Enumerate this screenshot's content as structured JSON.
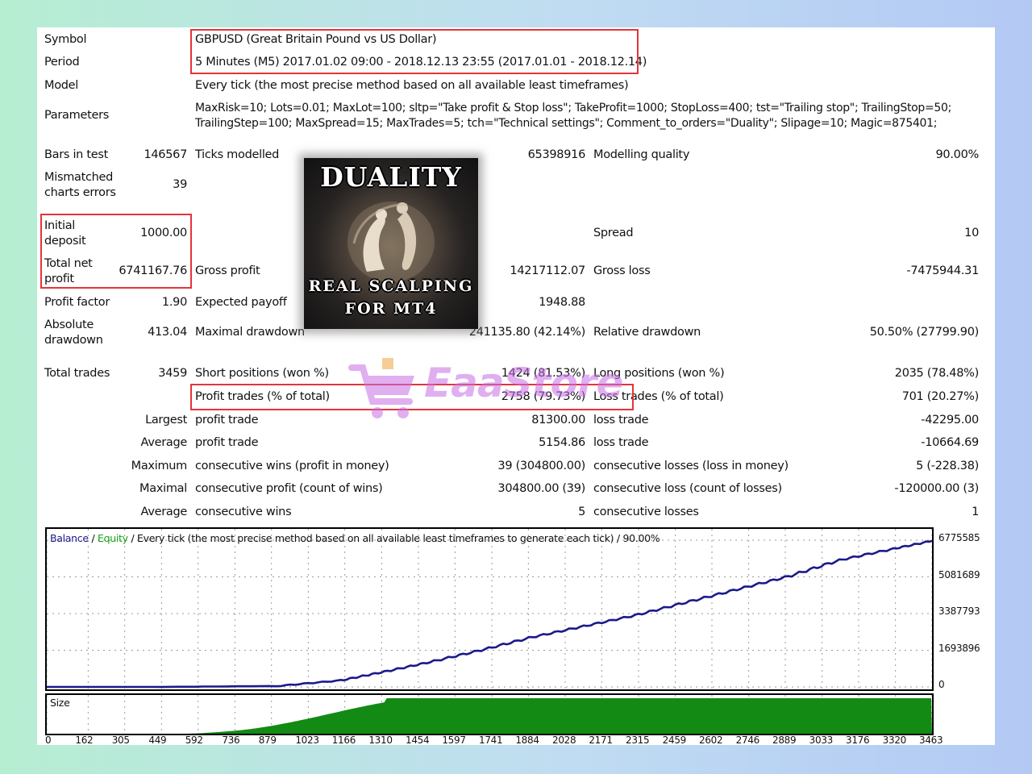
{
  "report": {
    "symbol_label": "Symbol",
    "symbol_value": "GBPUSD (Great Britain Pound vs US Dollar)",
    "period_label": "Period",
    "period_value": "5 Minutes (M5) 2017.01.02 09:00 - 2018.12.13 23:55 (2017.01.01 - 2018.12.14)",
    "model_label": "Model",
    "model_value": "Every tick (the most precise method based on all available least timeframes)",
    "parameters_label": "Parameters",
    "parameters_line1": "MaxRisk=10; Lots=0.01; MaxLot=100; sltp=\"Take profit & Stop loss\"; TakeProfit=1000; StopLoss=400; tst=\"Trailing stop\"; TrailingStop=50;",
    "parameters_line2": "TrailingStep=100; MaxSpread=15; MaxTrades=5; tch=\"Technical settings\"; Comment_to_orders=\"Duality\"; Slipage=10; Magic=875401;"
  },
  "stats": {
    "bars_label": "Bars in test",
    "bars_value": "146567",
    "ticks_label": "Ticks modelled",
    "ticks_value": "65398916",
    "quality_label": "Modelling quality",
    "quality_value": "90.00%",
    "mismatch_label_1": "Mismatched",
    "mismatch_label_2": "charts errors",
    "mismatch_value": "39",
    "deposit_label_1": "Initial",
    "deposit_label_2": "deposit",
    "deposit_value": "1000.00",
    "spread_label": "Spread",
    "spread_value": "10",
    "netprofit_label_1": "Total net",
    "netprofit_label_2": "profit",
    "netprofit_value": "6741167.76",
    "grossprofit_label": "Gross profit",
    "grossprofit_value": "14217112.07",
    "grossloss_label": "Gross loss",
    "grossloss_value": "-7475944.31",
    "profitfactor_label": "Profit factor",
    "profitfactor_value": "1.90",
    "expected_label": "Expected payoff",
    "expected_value": "1948.88",
    "absdd_label_1": "Absolute",
    "absdd_label_2": "drawdown",
    "absdd_value": "413.04",
    "maxdd_label": "Maximal drawdown",
    "maxdd_value": "241135.80 (42.14%)",
    "reldd_label": "Relative drawdown",
    "reldd_value": "50.50% (27799.90)",
    "trades_label": "Total trades",
    "trades_value": "3459",
    "short_label": "Short positions (won %)",
    "short_value": "1424 (81.53%)",
    "long_label": "Long positions (won %)",
    "long_value": "2035 (78.48%)",
    "profittrades_label": "Profit trades (% of total)",
    "profittrades_value": "2758 (79.73%)",
    "losstrades_label": "Loss trades (% of total)",
    "losstrades_value": "701 (20.27%)",
    "largest_label": "Largest",
    "largest_profit_label": "profit trade",
    "largest_profit_value": "81300.00",
    "largest_loss_label": "loss trade",
    "largest_loss_value": "-42295.00",
    "average_label": "Average",
    "average_profit_label": "profit trade",
    "average_profit_value": "5154.86",
    "average_loss_label": "loss trade",
    "average_loss_value": "-10664.69",
    "maximum_label": "Maximum",
    "maximum_wins_label": "consecutive wins (profit in money)",
    "maximum_wins_value": "39 (304800.00)",
    "maximum_losses_label": "consecutive losses (loss in money)",
    "maximum_losses_value": "5 (-228.38)",
    "maximal_label": "Maximal",
    "maximal_profit_label": "consecutive profit (count of wins)",
    "maximal_profit_value": "304800.00 (39)",
    "maximal_loss_label": "consecutive loss (count of losses)",
    "maximal_loss_value": "-120000.00 (3)",
    "avgcons_label": "Average",
    "avgcons_wins_label": "consecutive wins",
    "avgcons_wins_value": "5",
    "avgcons_losses_label": "consecutive losses",
    "avgcons_losses_value": "1"
  },
  "logo": {
    "title": "DUALITY",
    "subtitle_1": "REAL SCALPING",
    "subtitle_2": "FOR MT4"
  },
  "watermark": {
    "text": "EaaStore"
  },
  "colors": {
    "highlight_border": "#e3353a",
    "balance_line": "#1a1a8c",
    "equity_line": "#17a317",
    "size_fill": "#138a13"
  },
  "chart_data": {
    "type": "line",
    "legend_balance": "Balance",
    "legend_sep": " / ",
    "legend_equity": "Equity",
    "legend_rest": " / Every tick (the most precise method based on all available least timeframes to generate each tick) / 90.00%",
    "y_ticks": [
      "6775585",
      "5081689",
      "3387793",
      "1693896",
      "0"
    ],
    "y_tick_values": [
      6775585,
      5081689,
      3387793,
      1693896,
      0
    ],
    "x_ticks": [
      "0",
      "162",
      "305",
      "449",
      "592",
      "736",
      "879",
      "1023",
      "1166",
      "1310",
      "1454",
      "1597",
      "1741",
      "1884",
      "2028",
      "2171",
      "2315",
      "2459",
      "2602",
      "2746",
      "2889",
      "3033",
      "3176",
      "3320",
      "3463"
    ],
    "ylim": [
      0,
      6775585
    ],
    "xlim": [
      0,
      3463
    ],
    "grid": true,
    "series": [
      {
        "name": "Balance",
        "x": [
          0,
          450,
          900,
          1150,
          1320,
          1500,
          1700,
          1900,
          2100,
          2300,
          2500,
          2700,
          2900,
          3100,
          3300,
          3463
        ],
        "values": [
          0,
          0,
          40000,
          300000,
          700000,
          1150000,
          1700000,
          2300000,
          2800000,
          3300000,
          3900000,
          4500000,
          5100000,
          5850000,
          6350000,
          6741168
        ]
      }
    ],
    "size_panel_label": "Size"
  }
}
